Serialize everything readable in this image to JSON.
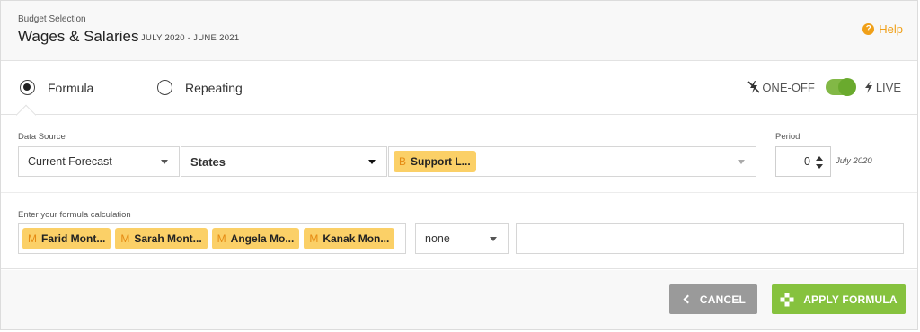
{
  "header": {
    "label": "Budget Selection",
    "title": "Wages & Salaries",
    "period_range": "JULY 2020 - JUNE 2021",
    "help_label": "Help",
    "help_icon": "question-circle-icon"
  },
  "mode": {
    "options": [
      {
        "label": "Formula",
        "selected": true
      },
      {
        "label": "Repeating",
        "selected": false
      }
    ],
    "toggle": {
      "left_label": "ONE-OFF",
      "right_label": "LIVE",
      "left_icon": "flash-off-icon",
      "right_icon": "flash-icon",
      "state": "on"
    }
  },
  "data_source": {
    "label": "Data Source",
    "source_value": "Current Forecast",
    "category_value": "States",
    "tags": [
      {
        "prefix": "B",
        "label": "Support L..."
      }
    ]
  },
  "period": {
    "label": "Period",
    "value": "0",
    "date": "July 2020"
  },
  "formula": {
    "label": "Enter your formula calculation",
    "tags": [
      {
        "prefix": "M",
        "label": "Farid Mont..."
      },
      {
        "prefix": "M",
        "label": "Sarah Mont..."
      },
      {
        "prefix": "M",
        "label": "Angela Mo..."
      },
      {
        "prefix": "M",
        "label": "Kanak Mon..."
      }
    ],
    "operator": "none",
    "value": ""
  },
  "footer": {
    "cancel_label": "CANCEL",
    "apply_label": "APPLY FORMULA"
  },
  "colors": {
    "accent_green": "#86c23e",
    "help_orange": "#f0a018",
    "tag_yellow": "#fbd067",
    "cancel_gray": "#9a9a9a"
  }
}
